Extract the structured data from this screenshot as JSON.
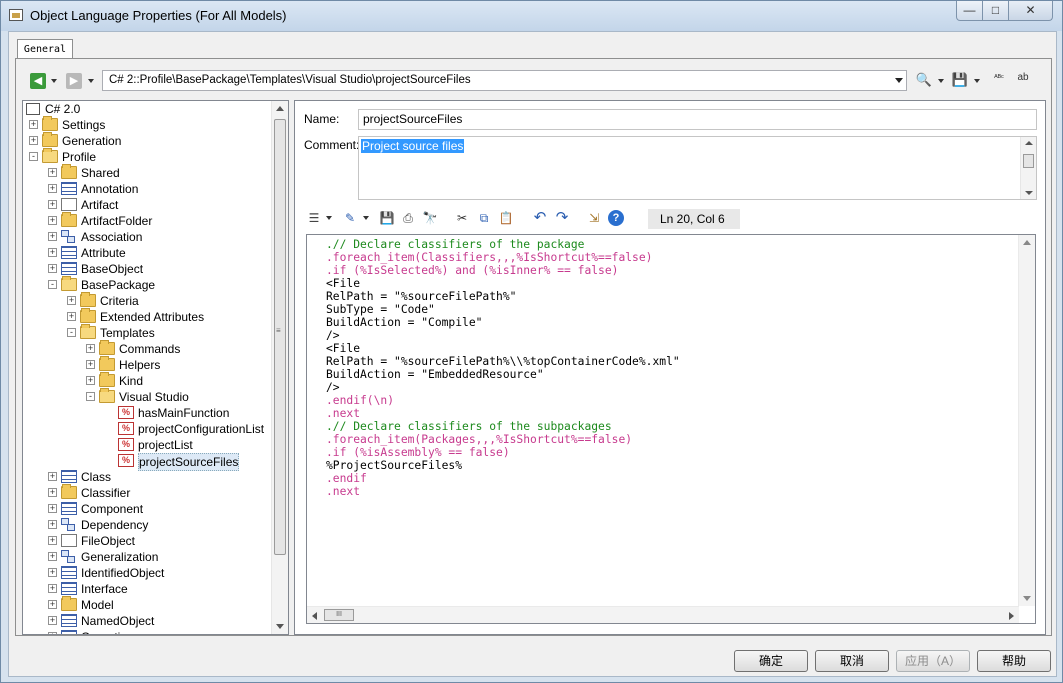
{
  "window": {
    "title": "Object Language Properties (For All Models)",
    "controls": {
      "minimize": "—",
      "maximize": "□",
      "close": "✕"
    }
  },
  "tabs": [
    {
      "label": "General"
    }
  ],
  "toolbar": {
    "path": "C# 2::Profile\\BasePackage\\Templates\\Visual Studio\\projectSourceFiles",
    "icons": [
      "back-icon",
      "forward-icon",
      "search-icon",
      "save-icon",
      "spellcheck-icon",
      "replace-text-icon"
    ],
    "back_glyph": "◀",
    "forward_glyph": "▶",
    "search_glyph": "🔍",
    "save_glyph": "💾",
    "spell_glyph": "ᴬᴮᶜ",
    "replace_glyph": "ab"
  },
  "tree": {
    "root": "C# 2.0",
    "items": [
      {
        "label": "Settings"
      },
      {
        "label": "Generation"
      },
      {
        "label": "Profile"
      },
      {
        "label": "Shared"
      },
      {
        "label": "Annotation"
      },
      {
        "label": "Artifact"
      },
      {
        "label": "ArtifactFolder"
      },
      {
        "label": "Association"
      },
      {
        "label": "Attribute"
      },
      {
        "label": "BaseObject"
      },
      {
        "label": "BasePackage"
      },
      {
        "label": "Criteria"
      },
      {
        "label": "Extended Attributes"
      },
      {
        "label": "Templates"
      },
      {
        "label": "Commands"
      },
      {
        "label": "Helpers"
      },
      {
        "label": "Kind"
      },
      {
        "label": "Visual Studio"
      },
      {
        "label": "hasMainFunction"
      },
      {
        "label": "projectConfigurationList"
      },
      {
        "label": "projectList"
      },
      {
        "label": "projectSourceFiles"
      },
      {
        "label": "Class"
      },
      {
        "label": "Classifier"
      },
      {
        "label": "Component"
      },
      {
        "label": "Dependency"
      },
      {
        "label": "FileObject"
      },
      {
        "label": "Generalization"
      },
      {
        "label": "IdentifiedObject"
      },
      {
        "label": "Interface"
      },
      {
        "label": "Model"
      },
      {
        "label": "NamedObject"
      },
      {
        "label": "Operation"
      }
    ],
    "template_glyph": "%",
    "grip": "≡"
  },
  "form": {
    "name_label": "Name:",
    "name_value": "projectSourceFiles",
    "comment_label": "Comment:",
    "comment_value": "Project source files"
  },
  "editor_toolbar": {
    "icons": [
      "list-icon",
      "edit-icon",
      "save-icon",
      "print-icon",
      "find-icon",
      "cut-icon",
      "copy-icon",
      "paste-icon",
      "undo-icon",
      "redo-icon",
      "insert-icon",
      "help-icon"
    ],
    "glyphs": {
      "list": "☰",
      "edit": "✎",
      "save": "💾",
      "print": "⎙",
      "find": "🔭",
      "cut": "✂",
      "copy": "⧉",
      "paste": "📋",
      "undo": "↶",
      "redo": "↷",
      "insert": "⇲",
      "help": "?"
    },
    "position": "Ln 20, Col 6"
  },
  "code_lines": [
    {
      "type": "com",
      "text": ".// Declare classifiers of the package"
    },
    {
      "type": "cmd",
      "text": ".foreach_item(Classifiers,,,%IsShortcut%==false)"
    },
    {
      "type": "cmd",
      "text": ".if (%IsSelected%) and (%isInner% == false)"
    },
    {
      "type": "txt",
      "text": "<File"
    },
    {
      "type": "txt",
      "text": "RelPath = \"%sourceFilePath%\""
    },
    {
      "type": "txt",
      "text": "SubType = \"Code\""
    },
    {
      "type": "txt",
      "text": "BuildAction = \"Compile\""
    },
    {
      "type": "txt",
      "text": "/>"
    },
    {
      "type": "txt",
      "text": "<File"
    },
    {
      "type": "txt",
      "text": "RelPath = \"%sourceFilePath%\\\\%topContainerCode%.xml\""
    },
    {
      "type": "txt",
      "text": "BuildAction = \"EmbeddedResource\""
    },
    {
      "type": "txt",
      "text": "/>"
    },
    {
      "type": "cmd",
      "text": ".endif(\\n)"
    },
    {
      "type": "cmd",
      "text": ".next"
    },
    {
      "type": "com",
      "text": ".// Declare classifiers of the subpackages"
    },
    {
      "type": "cmd",
      "text": ".foreach_item(Packages,,,%IsShortcut%==false)"
    },
    {
      "type": "cmd",
      "text": ".if (%isAssembly% == false)"
    },
    {
      "type": "txt",
      "text": "%ProjectSourceFiles%"
    },
    {
      "type": "cmd",
      "text": ".endif"
    },
    {
      "type": "cmd",
      "text": ".next"
    }
  ],
  "scroll": {
    "thumb_grip": "III"
  },
  "buttons": {
    "ok": "确定",
    "cancel": "取消",
    "apply": "应用（A）",
    "help": "帮助"
  }
}
